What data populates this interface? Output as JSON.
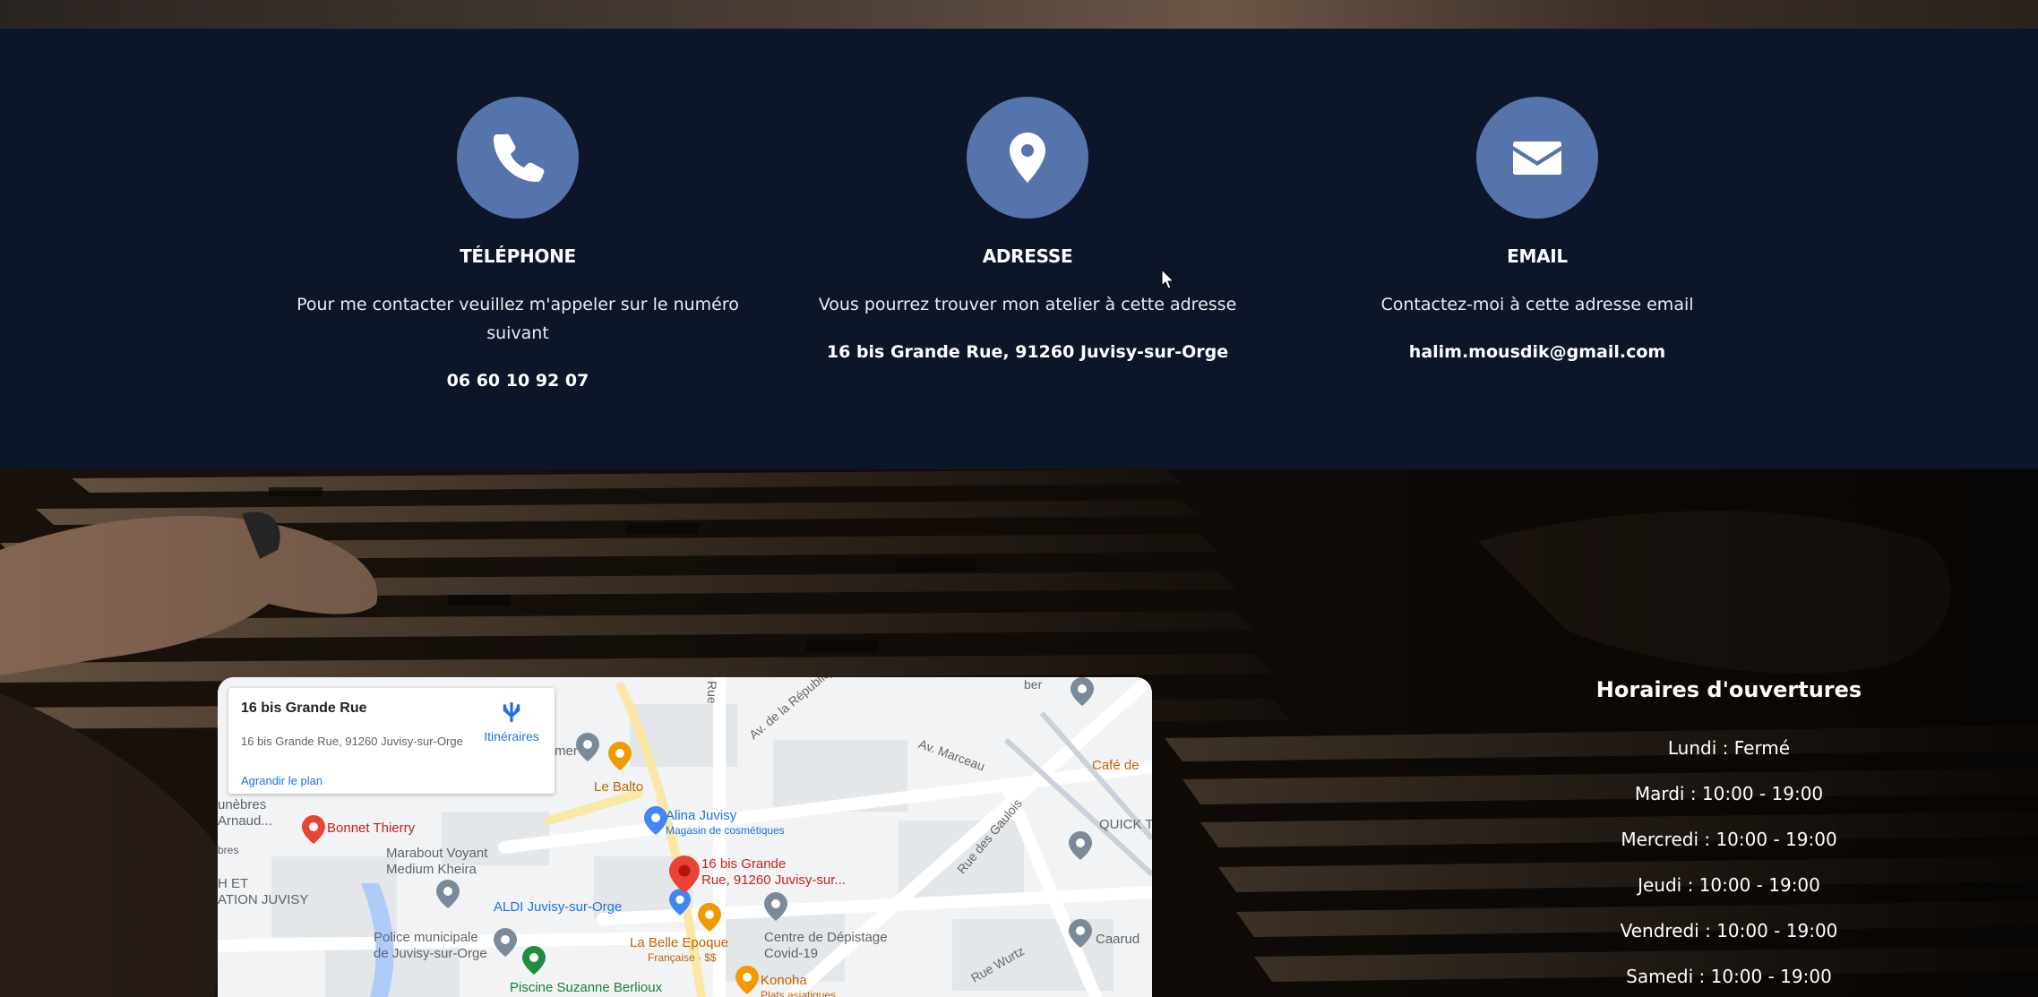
{
  "contact": {
    "phone": {
      "icon": "phone-icon",
      "title": "TÉLÉPHONE",
      "description": "Pour me contacter veuillez m'appeler sur le numéro suivant",
      "value": "06 60 10 92 07"
    },
    "address": {
      "icon": "map-pin-icon",
      "title": "ADRESSE",
      "description": "Vous pourrez trouver mon atelier à cette adresse",
      "value": "16 bis Grande Rue, 91260 Juvisy-sur-Orge"
    },
    "email": {
      "icon": "envelope-icon",
      "title": "EMAIL",
      "description": "Contactez-moi à cette adresse email",
      "value": "halim.mousdik@gmail.com"
    },
    "icon_color": "#5574ac",
    "band_color": "#0d1628"
  },
  "map": {
    "card": {
      "title": "16 bis Grande Rue",
      "address": "16 bis Grande Rue, 91260 Juvisy-sur-Orge",
      "enlarge_link": "Agrandir le plan",
      "route_label": "Itinéraires"
    },
    "places": {
      "le_balto": "Le Balto",
      "mer": "mer",
      "alina": "Alina Juvisy",
      "alina_sub": "Magasin de cosmétiques",
      "bonnet": "Bonnet Thierry",
      "marabout_1": "Marabout Voyant",
      "marabout_2": "Medium Kheira",
      "aldi": "ALDI Juvisy-sur-Orge",
      "pin_1": "16 bis Grande",
      "pin_2": "Rue, 91260 Juvisy-sur...",
      "belle_epoque": "La Belle Epoque",
      "belle_epoque_sub": "Française · $$",
      "centre_1": "Centre de Dépistage",
      "centre_2": "Covid-19",
      "police_1": "Police municipale",
      "police_2": "de Juvisy-sur-Orge",
      "piscine": "Piscine Suzanne Berlioux",
      "konoha": "Konoha",
      "konoha_sub": "Plats asiatiques",
      "cafe": "Café de",
      "quick": "QUICK T",
      "caaruda": "Caarud",
      "funebres_1": "unèbres",
      "funebres_2": "Arnaud...",
      "bres": "bres",
      "het": "H ET",
      "ation": "ATION JUVISY",
      "road_republique": "Av. de la République",
      "road_marceau": "Av. Marceau",
      "road_gaulois": "Rue des Gaulois",
      "road_wurtz": "Rue Wurtz",
      "road_rue": "Rue",
      "road_ber": "ber"
    }
  },
  "hours": {
    "title": "Horaires d'ouvertures",
    "days": [
      "Lundi : Fermé",
      "Mardi : 10:00 - 19:00",
      "Mercredi : 10:00 - 19:00",
      "Jeudi : 10:00 - 19:00",
      "Vendredi : 10:00 - 19:00",
      "Samedi : 10:00 - 19:00"
    ]
  }
}
